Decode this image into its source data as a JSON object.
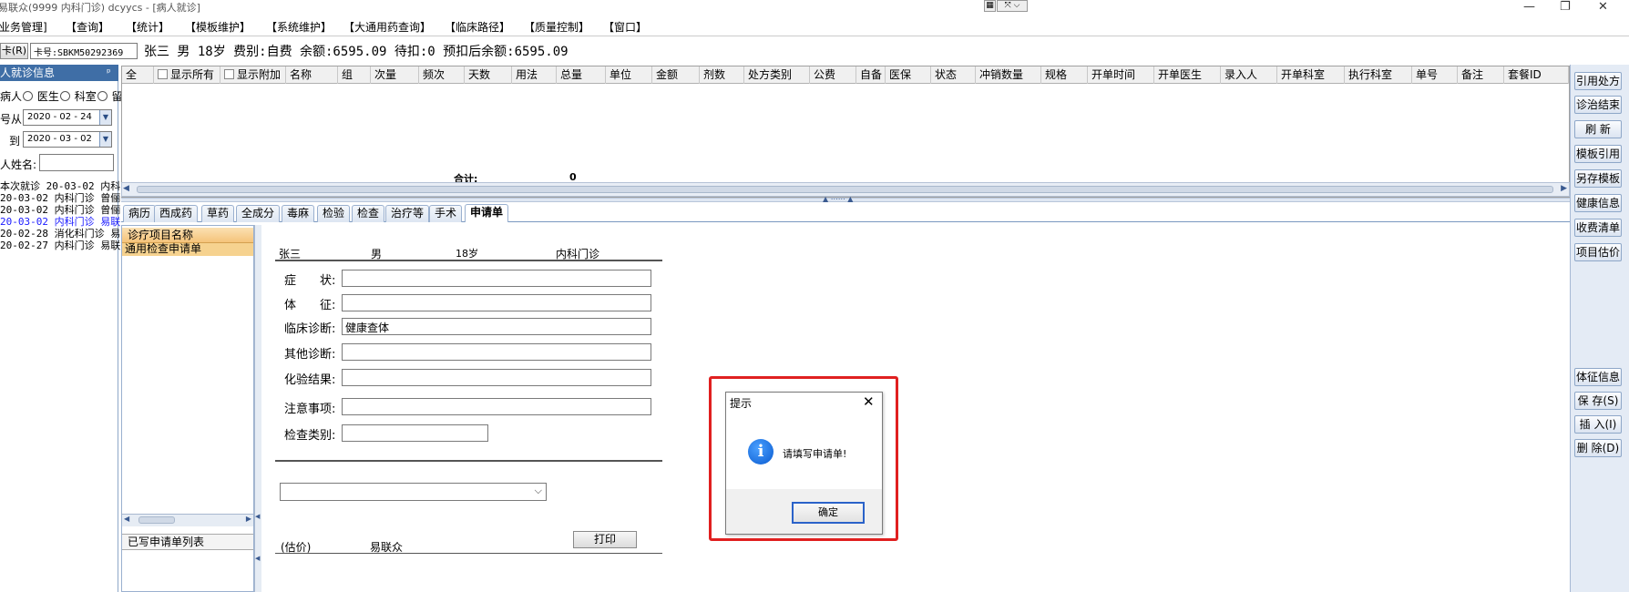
{
  "window": {
    "title": "易联众(9999 内科门诊) dcyycs - [病人就诊]",
    "controls": {
      "minimize": "—",
      "maximize": "❐",
      "close": "✕"
    }
  },
  "menu": {
    "items": [
      "业务管理]",
      "【查询】",
      "【统计】",
      "【模板维护】",
      "【系统维护】",
      "【大通用药查询】",
      "【临床路径】",
      "【质量控制】",
      "【窗口】"
    ]
  },
  "cardrow": {
    "card_button": "卡(R)",
    "card_no": "卡号:SBKM50292369",
    "info": "张三 男 18岁 费别:自费 余额:6595.09 待扣:0 预扣后余额:6595.09"
  },
  "leftpanel": {
    "header": "人就诊信息",
    "pin": "ᵖ",
    "radio_patient": "病人",
    "radio_doctor": "医生",
    "radio_dept": "科室",
    "radio_keep": "留",
    "date_from_label": "号从",
    "date_from": "2020 - 02 - 24",
    "date_to_label": "到",
    "date_to": "2020 - 03 - 02",
    "name_label": "人姓名:",
    "visits": [
      {
        "text": "本次就诊 20-03-02 内科",
        "color": "#000000"
      },
      {
        "text": "20-03-02 内科门诊 曾俪",
        "color": "#000000"
      },
      {
        "text": "20-03-02 内科门诊 曾俪",
        "color": "#000000"
      },
      {
        "text": "20-03-02 内科门诊 易联",
        "color": "#1a1aff"
      },
      {
        "text": "20-02-28 消化科门诊 易",
        "color": "#000000"
      },
      {
        "text": "20-02-27 内科门诊 易联",
        "color": "#000000"
      }
    ]
  },
  "grid": {
    "headers": [
      "全",
      "显示所有",
      "显示附加",
      "名称",
      "组",
      "次量",
      "频次",
      "天数",
      "用法",
      "总量",
      "单位",
      "金额",
      "剂数",
      "处方类别",
      "公费",
      "自备",
      "医保",
      "状态",
      "冲销数量",
      "规格",
      "开单时间",
      "开单医生",
      "录入人",
      "开单科室",
      "执行科室",
      "单号",
      "备注",
      "套餐ID"
    ],
    "total_label": "合计:",
    "total_value": "0"
  },
  "tabs": [
    "病历",
    "西成药",
    "草药",
    "全成分",
    "毒麻",
    "检验",
    "检查",
    "治疗等",
    "手术",
    "申请单"
  ],
  "right_buttons_top": [
    "引用处方",
    "诊治结束",
    "刷 新",
    "模板引用",
    "另存模板",
    "健康信息",
    "收费清单",
    "项目估价"
  ],
  "right_buttons_bottom": [
    "体征信息",
    "保 存(S)",
    "插 入(I)",
    "删 除(D)"
  ],
  "itempanel": {
    "header": "诊疗项目名称",
    "selected": "通用检查申请单",
    "list_header": "已写申请单列表"
  },
  "form": {
    "patient_name": "张三",
    "patient_sex": "男",
    "patient_age": "18岁",
    "patient_dept": "内科门诊",
    "fields": [
      {
        "label": "症　　状:",
        "value": ""
      },
      {
        "label": "体　　征:",
        "value": ""
      },
      {
        "label": "临床诊断:",
        "value": "健康查体"
      },
      {
        "label": "其他诊断:",
        "value": ""
      },
      {
        "label": "化验结果:",
        "value": ""
      },
      {
        "label": "注意事项:",
        "value": ""
      },
      {
        "label": "检查类别:",
        "value": ""
      }
    ],
    "select_value": "",
    "print_button": "打印",
    "price_label": "(估价)",
    "org": "易联众"
  },
  "dialog": {
    "title": "提示",
    "message": "请填写申请单!",
    "ok": "确定",
    "highlight_color": "#e02020"
  }
}
